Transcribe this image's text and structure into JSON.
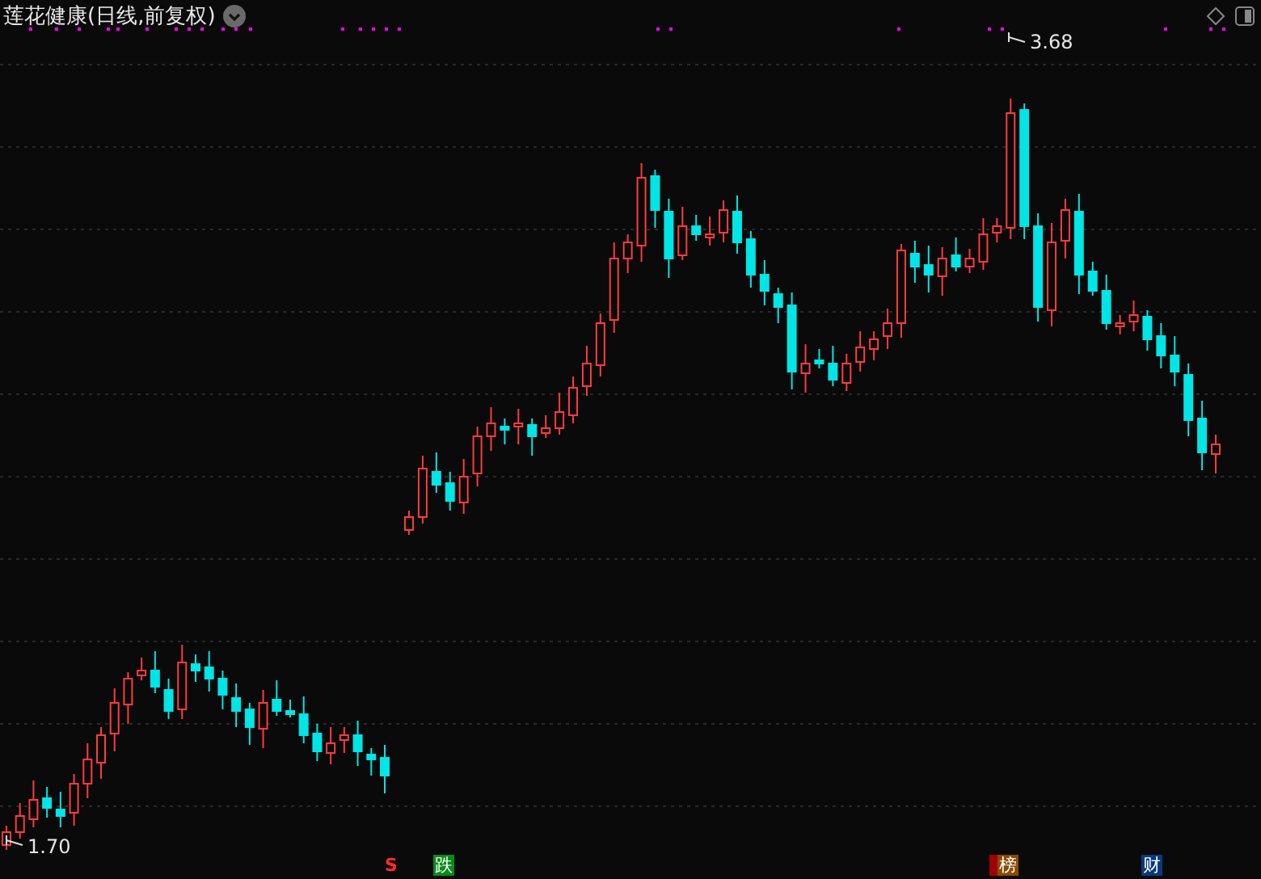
{
  "title": "莲花健康(日线,前复权)",
  "high_label": "3.68",
  "low_label": "1.70",
  "markers": [
    {
      "kind": "signal",
      "text": "S"
    },
    {
      "kind": "down",
      "text": "跌"
    },
    {
      "kind": "rank",
      "text": "榜"
    },
    {
      "kind": "finance",
      "text": "财"
    }
  ]
}
